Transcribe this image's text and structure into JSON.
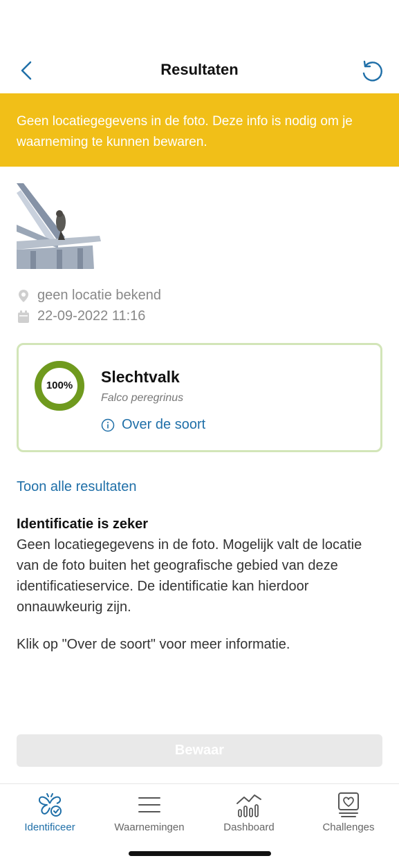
{
  "header": {
    "title": "Resultaten",
    "back_icon": "chevron-left-icon",
    "refresh_icon": "refresh-icon"
  },
  "banner": {
    "text": "Geen locatiegegevens in de foto. Deze info is nodig om je waarneming te kunnen bewaren.",
    "color": "#f1bf18"
  },
  "photo": {
    "subject": "falcon-photo"
  },
  "meta": {
    "location": "geen locatie bekend",
    "datetime": "22-09-2022 11:16"
  },
  "result": {
    "confidence_label": "100%",
    "confidence": 1.0,
    "species": "Slechtvalk",
    "latin": "Falco peregrinus",
    "about_label": "Over de soort",
    "ring_color": "#6f9a1e"
  },
  "show_all_label": "Toon alle resultaten",
  "identification": {
    "title": "Identificatie is zeker",
    "body": "Geen locatiegegevens in de foto. Mogelijk valt de locatie van de foto buiten het geografische gebied van deze identificatieservice. De identificatie kan hierdoor onnauwkeurig zijn.",
    "hint": "Klik op \"Over de soort\" voor meer informatie."
  },
  "save_label": "Bewaar",
  "tabs": [
    {
      "label": "Identificeer",
      "icon": "butterfly-check-icon",
      "active": true
    },
    {
      "label": "Waarnemingen",
      "icon": "list-icon",
      "active": false
    },
    {
      "label": "Dashboard",
      "icon": "chart-icon",
      "active": false
    },
    {
      "label": "Challenges",
      "icon": "heart-badge-icon",
      "active": false
    }
  ],
  "accent_color": "#1f6fa8"
}
